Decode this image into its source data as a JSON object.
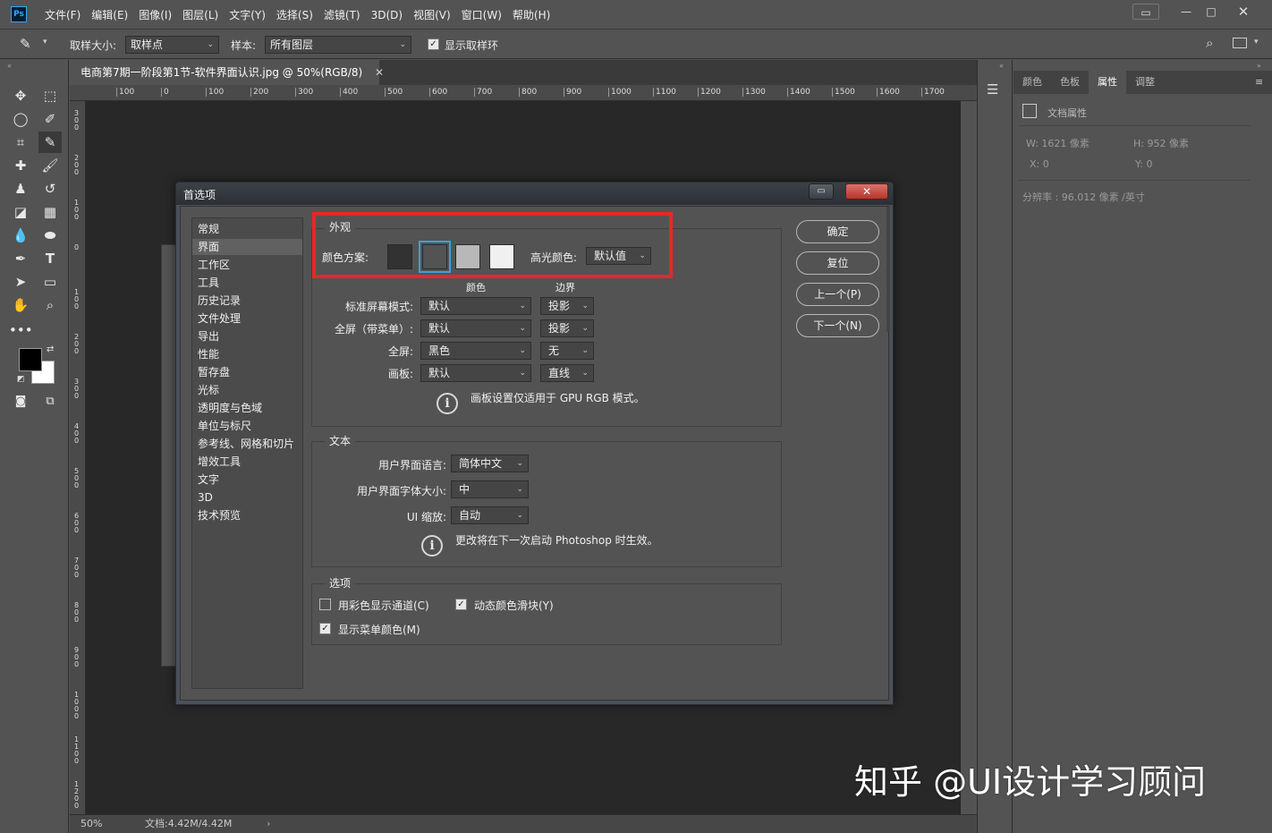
{
  "app": {
    "logo": "Ps"
  },
  "menu": [
    "文件(F)",
    "编辑(E)",
    "图像(I)",
    "图层(L)",
    "文字(Y)",
    "选择(S)",
    "滤镜(T)",
    "3D(D)",
    "视图(V)",
    "窗口(W)",
    "帮助(H)"
  ],
  "options_bar": {
    "sample_size_label": "取样大小:",
    "sample_size_value": "取样点",
    "sample_label": "样本:",
    "sample_value": "所有图层",
    "show_ring_label": "显示取样环",
    "show_ring_checked": true
  },
  "document": {
    "tab_title": "电商第7期一阶段第1节-软件界面认识.jpg @ 50%(RGB/8)",
    "zoom": "50%",
    "doc_info": "文档:4.42M/4.42M",
    "ruler_top": [
      "100",
      "0",
      "100",
      "200",
      "300",
      "400",
      "500",
      "600",
      "700",
      "800",
      "900",
      "1000",
      "1100",
      "1200",
      "1300",
      "1400",
      "1500",
      "1600",
      "1700"
    ],
    "ruler_left": [
      "300",
      "200",
      "100",
      "0",
      "100",
      "200",
      "300",
      "400",
      "500",
      "600",
      "700",
      "800",
      "900",
      "1000",
      "1100",
      "1200"
    ]
  },
  "panels": {
    "tabs": [
      "颜色",
      "色板",
      "属性",
      "调整"
    ],
    "active_tab": "属性",
    "doc_props_label": "文档属性",
    "w": "W:  1621 像素",
    "h": "H:  952 像素",
    "x": "X:  0",
    "y": "Y:  0",
    "resolution": "分辨率 : 96.012 像素 /英寸"
  },
  "dialog": {
    "title": "首选项",
    "categories": [
      "常规",
      "界面",
      "工作区",
      "工具",
      "历史记录",
      "文件处理",
      "导出",
      "性能",
      "暂存盘",
      "光标",
      "透明度与色域",
      "单位与标尺",
      "参考线、网格和切片",
      "增效工具",
      "文字",
      "3D",
      "技术预览"
    ],
    "selected_category": "界面",
    "buttons": {
      "ok": "确定",
      "reset": "复位",
      "prev": "上一个(P)",
      "next": "下一个(N)"
    },
    "appearance": {
      "title": "外观",
      "color_scheme_label": "颜色方案:",
      "swatch_colors": [
        "#323232",
        "#535353",
        "#b8b8b8",
        "#f0f0f0"
      ],
      "highlight_label": "高光颜色:",
      "highlight_value": "默认值",
      "col_color": "颜色",
      "col_border": "边界",
      "rows": [
        {
          "label": "标准屏幕模式:",
          "color": "默认",
          "border": "投影"
        },
        {
          "label": "全屏（带菜单）:",
          "color": "默认",
          "border": "投影"
        },
        {
          "label": "全屏:",
          "color": "黑色",
          "border": "无"
        },
        {
          "label": "画板:",
          "color": "默认",
          "border": "直线"
        }
      ],
      "note": "画板设置仅适用于 GPU RGB 模式。"
    },
    "text": {
      "title": "文本",
      "lang_label": "用户界面语言:",
      "lang_value": "简体中文",
      "font_size_label": "用户界面字体大小:",
      "font_size_value": "中",
      "ui_scale_label": "UI 缩放:",
      "ui_scale_value": "自动",
      "note": "更改将在下一次启动 Photoshop 时生效。"
    },
    "options": {
      "title": "选项",
      "channels_color": {
        "label": "用彩色显示通道(C)",
        "checked": false
      },
      "dynamic_sliders": {
        "label": "动态颜色滑块(Y)",
        "checked": true
      },
      "menu_colors": {
        "label": "显示菜单颜色(M)",
        "checked": true
      }
    }
  },
  "watermark": "知乎 @UI设计学习顾问"
}
